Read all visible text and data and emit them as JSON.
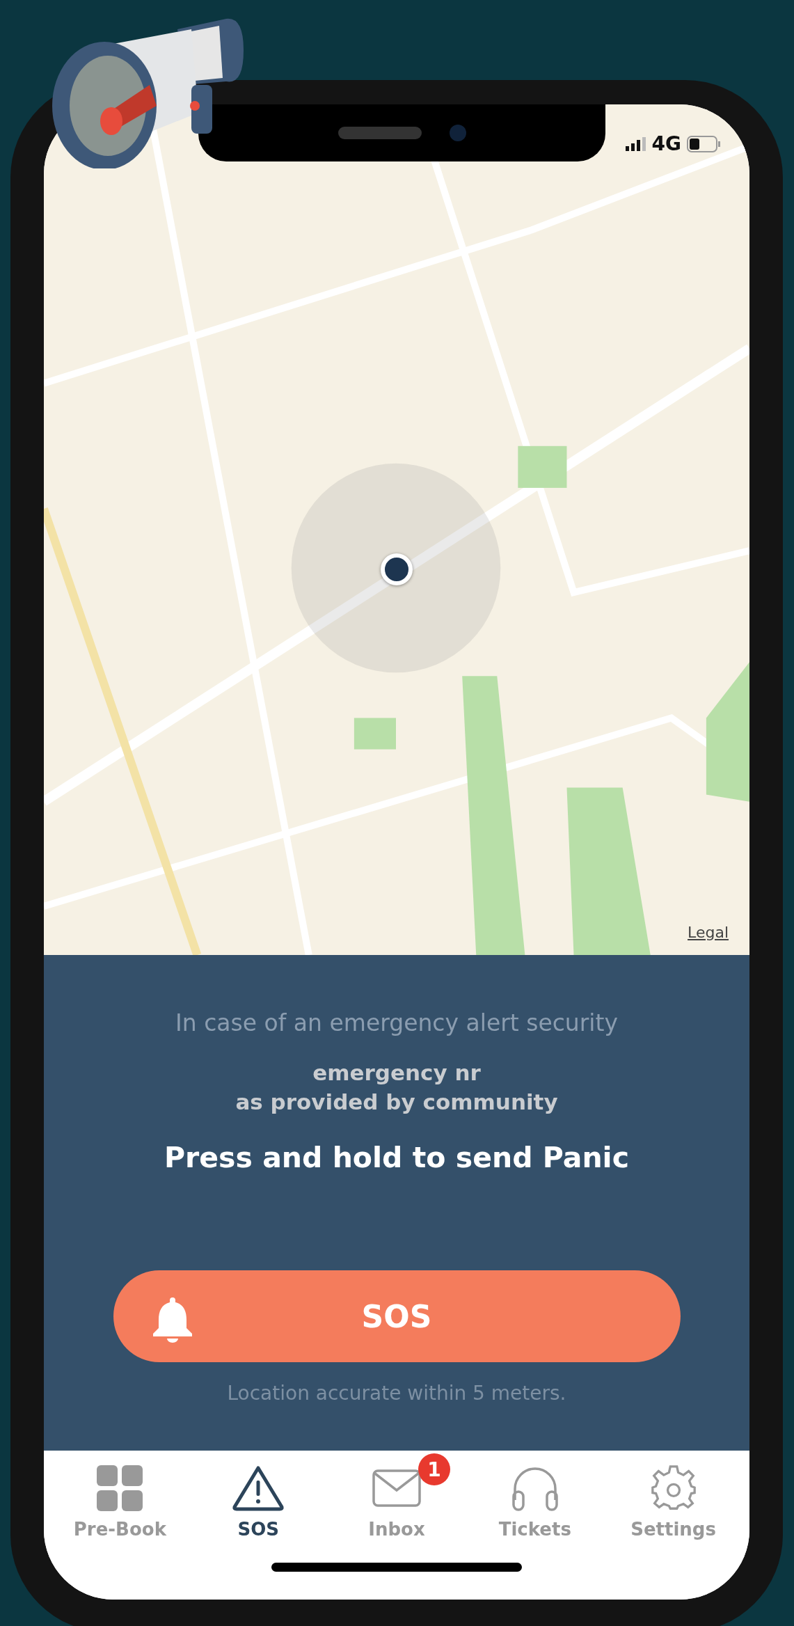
{
  "status_bar": {
    "network": "4G"
  },
  "map": {
    "legal": "Legal"
  },
  "panel": {
    "notice": "In case of an emergency alert security",
    "number_label": "emergency nr",
    "number_note": "as provided by community",
    "instruction": "Press and hold to send Panic",
    "sos_button": "SOS",
    "accuracy": "Location accurate within 5 meters."
  },
  "tabs": [
    {
      "label": "Pre-Book",
      "kind": "grid",
      "selected": false
    },
    {
      "label": "SOS",
      "kind": "warning",
      "selected": true
    },
    {
      "label": "Inbox",
      "kind": "mail",
      "selected": false,
      "badge": "1"
    },
    {
      "label": "Tickets",
      "kind": "headset",
      "selected": false
    },
    {
      "label": "Settings",
      "kind": "gear",
      "selected": false
    }
  ]
}
